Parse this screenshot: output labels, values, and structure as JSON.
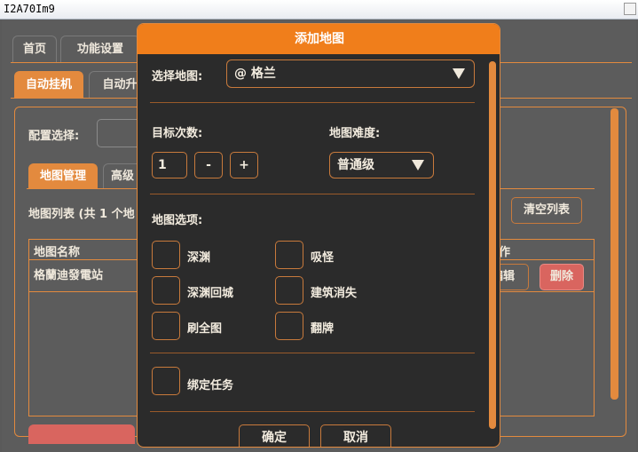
{
  "window": {
    "title": "I2A70Im9"
  },
  "top_tabs": [
    "首页",
    "功能设置"
  ],
  "sub_tabs": [
    "自动挂机",
    "自动升"
  ],
  "config": {
    "label": "配置选择:"
  },
  "inner_tabs": [
    "地图管理",
    "高级"
  ],
  "map_list": {
    "count_label": "地图列表 (共 1 个地",
    "clear_button": "清空列表",
    "column_name": "地图名称",
    "column_action": "作",
    "rows": [
      {
        "name": "格蘭迪發電站",
        "edit": "编辑",
        "delete": "删除"
      }
    ]
  },
  "dialog": {
    "title": "添加地图",
    "select_map_label": "选择地图:",
    "select_map_value": "@ 格兰",
    "target_count_label": "目标次数:",
    "target_count_value": "1",
    "minus": "-",
    "plus": "+",
    "difficulty_label": "地图难度:",
    "difficulty_value": "普通级",
    "options_label": "地图选项:",
    "options": [
      "深渊",
      "吸怪",
      "深渊回城",
      "建筑消失",
      "刷全图",
      "翻牌"
    ],
    "bind_task": "绑定任务",
    "confirm": "确定",
    "cancel": "取消"
  },
  "colors": {
    "accent": "#f07e1b",
    "panel": "#5c5c5c",
    "dialog_bg": "#2b2b2b",
    "delete": "#d9655f"
  }
}
